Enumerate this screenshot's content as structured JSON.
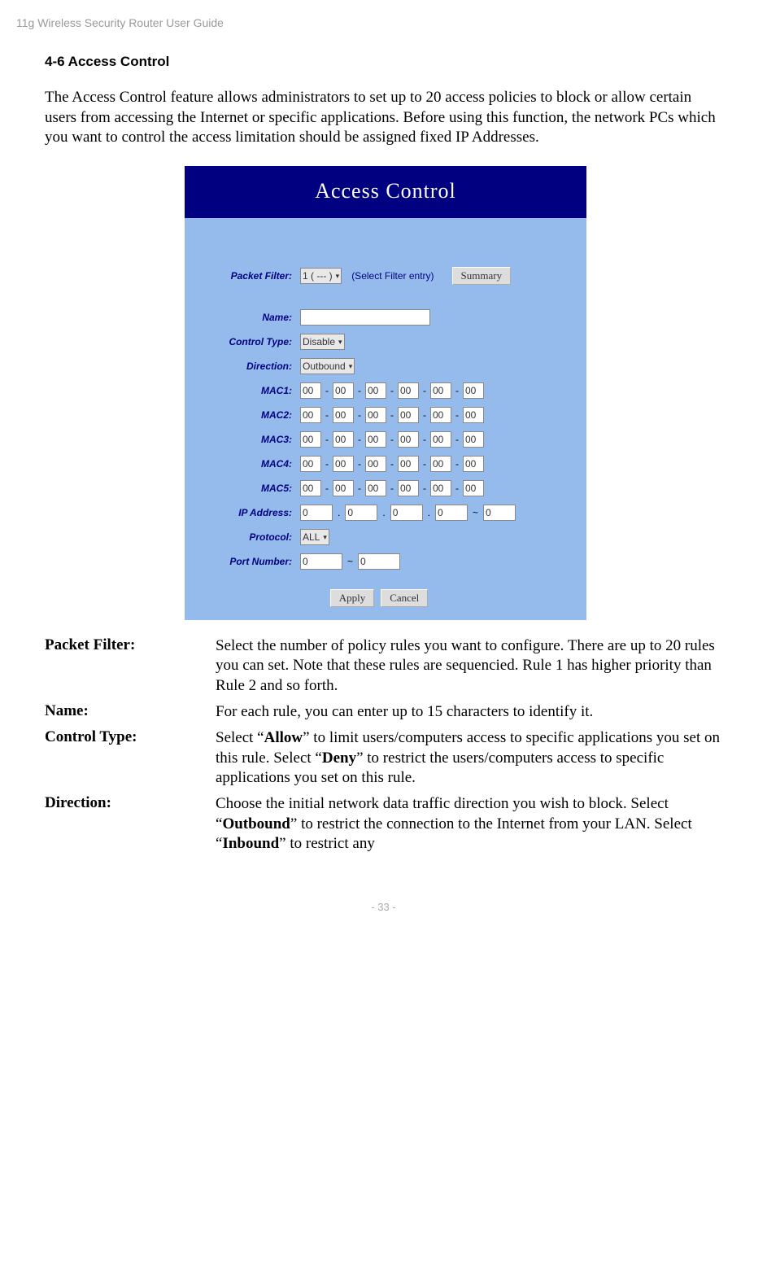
{
  "header": "11g Wireless Security Router User Guide",
  "section_heading": "4-6 Access Control",
  "intro": "The Access Control feature allows administrators to set up to 20 access policies to block or allow certain users from accessing the Internet or specific applications. Before using this function, the network PCs which you want to control the access limitation should be assigned fixed IP Addresses.",
  "screenshot": {
    "title": "Access Control",
    "labels": {
      "packet_filter": "Packet Filter:",
      "name": "Name:",
      "control_type": "Control Type:",
      "direction": "Direction:",
      "mac1": "MAC1:",
      "mac2": "MAC2:",
      "mac3": "MAC3:",
      "mac4": "MAC4:",
      "mac5": "MAC5:",
      "ip_address": "IP Address:",
      "protocol": "Protocol:",
      "port_number": "Port Number:"
    },
    "values": {
      "packet_filter_select": "1 ( --- )",
      "packet_filter_hint": "(Select Filter entry)",
      "summary_btn": "Summary",
      "name_value": "",
      "control_type_select": "Disable",
      "direction_select": "Outbound",
      "mac_octet": "00",
      "ip_octet": "0",
      "ip_range_end": "0",
      "protocol_select": "ALL",
      "port_start": "0",
      "port_end": "0",
      "apply_btn": "Apply",
      "cancel_btn": "Cancel"
    },
    "separators": {
      "mac": "-",
      "ip": ".",
      "tilde": "~"
    }
  },
  "definitions": {
    "packet_filter": {
      "term": "Packet Filter:",
      "desc": "Select the number of policy rules you want to configure. There are up to 20 rules you can set. Note that these rules are sequencied. Rule 1 has higher priority than Rule 2 and so forth."
    },
    "name": {
      "term": "Name:",
      "desc": "For each rule, you can enter up to 15 characters to identify it."
    },
    "control_type": {
      "term": "Control Type:",
      "desc_pre": "Select “",
      "allow": "Allow",
      "desc_mid1": "” to limit users/computers access to specific applications you set on this rule. Select “",
      "deny": "Deny",
      "desc_post": "” to restrict the users/computers access to specific applications you set on this rule."
    },
    "direction": {
      "term": "Direction:",
      "desc_pre": "Choose the initial network data traffic direction you wish to block. Select “",
      "outbound": "Outbound",
      "desc_mid1": "” to restrict the connection to the Internet from your LAN. Select “",
      "inbound": "Inbound",
      "desc_post": "” to restrict any"
    }
  },
  "footer": "- 33 -"
}
